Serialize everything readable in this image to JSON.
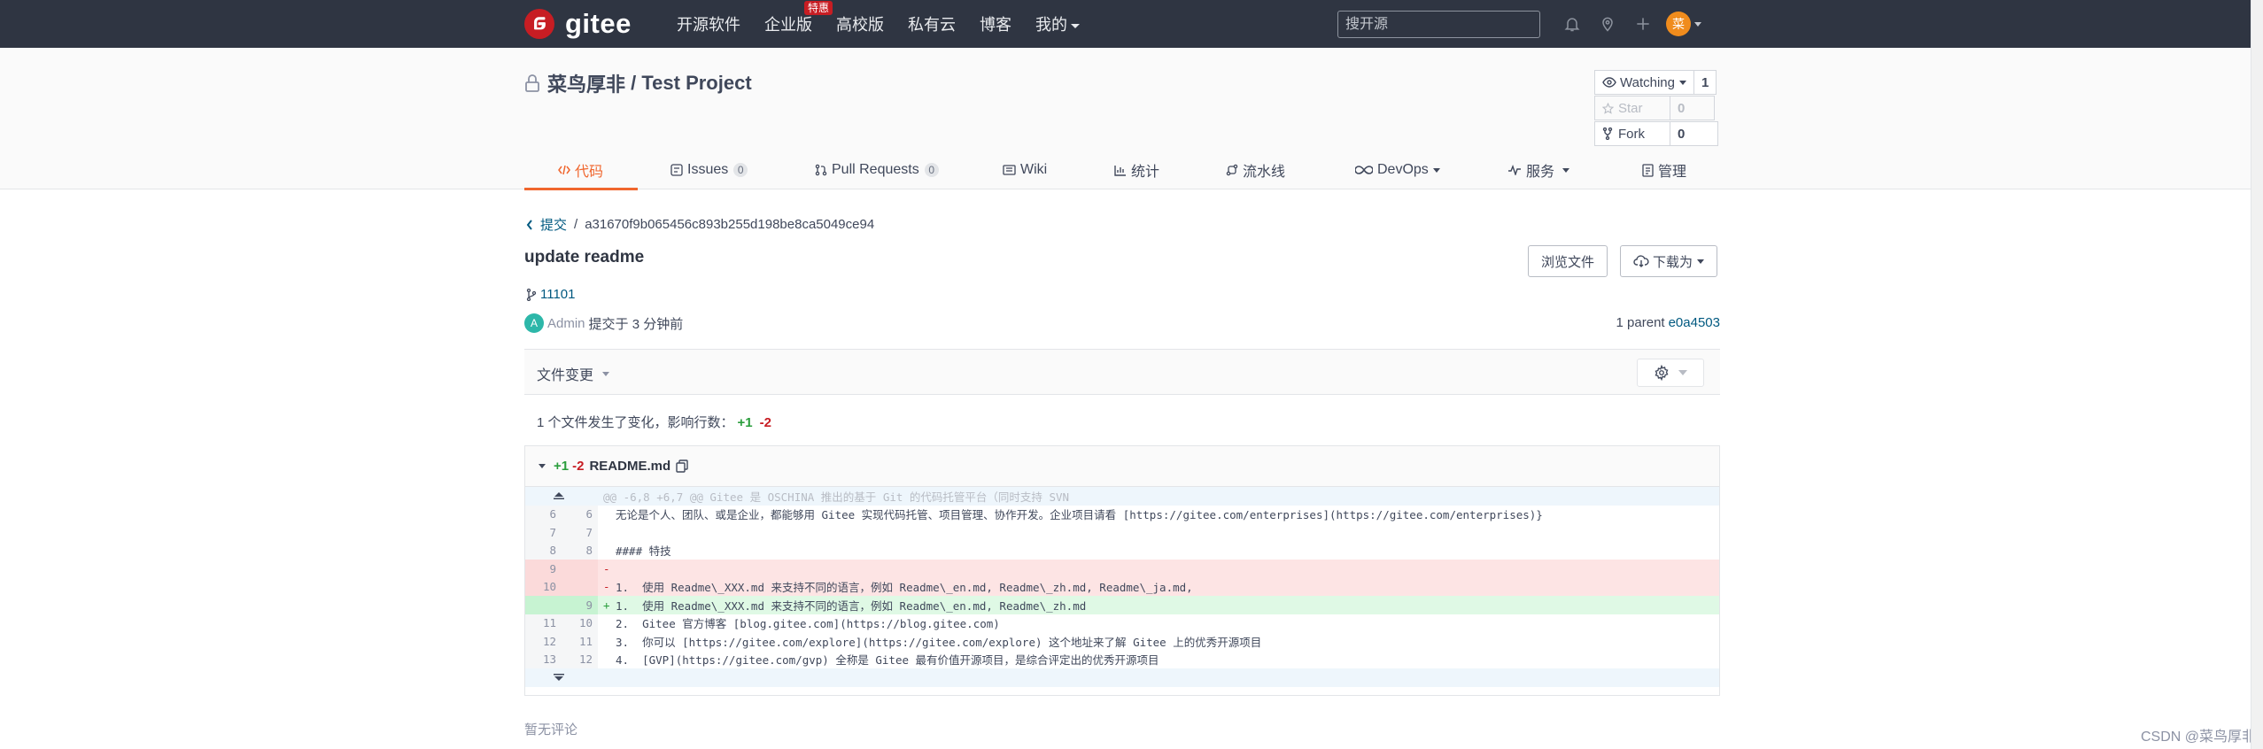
{
  "navbar": {
    "logo_text": "gitee",
    "items": [
      {
        "label": "开源软件"
      },
      {
        "label": "企业版",
        "badge": "特惠"
      },
      {
        "label": "高校版"
      },
      {
        "label": "私有云"
      },
      {
        "label": "博客"
      },
      {
        "label": "我的"
      }
    ],
    "search_placeholder": "搜开源",
    "avatar_text": "菜",
    "icons": [
      "bell-icon",
      "location-icon",
      "plus-icon"
    ]
  },
  "project": {
    "owner": "菜鸟厚非",
    "separator": " / ",
    "name": "Test Project",
    "watch": {
      "label": "Watching",
      "count": "1"
    },
    "star": {
      "label": "Star",
      "count": "0"
    },
    "fork": {
      "label": "Fork",
      "count": "0"
    }
  },
  "tabs": [
    {
      "label": "代码",
      "icon": "code-icon",
      "active": true
    },
    {
      "label": "Issues",
      "count": "0",
      "icon": "issues-icon"
    },
    {
      "label": "Pull Requests",
      "count": "0",
      "icon": "pull-request-icon"
    },
    {
      "label": "Wiki",
      "icon": "wiki-icon"
    },
    {
      "label": "统计",
      "icon": "stats-icon"
    },
    {
      "label": "流水线",
      "icon": "pipeline-icon"
    },
    {
      "label": "DevOps",
      "icon": "devops-icon"
    },
    {
      "label": "服务",
      "icon": "service-icon"
    },
    {
      "label": "管理",
      "icon": "manage-icon"
    }
  ],
  "commit": {
    "breadcrumb_link": "提交",
    "hash": "a31670f9b065456c893b255d198be8ca5049ce94",
    "title": "update readme",
    "browse_button": "浏览文件",
    "download_button": "下载为",
    "branch": "11101",
    "author_initial": "A",
    "author": "Admin",
    "committed_text": "提交于 3 分钟前",
    "parent_label": "1 parent",
    "parent_hash": "e0a4503"
  },
  "changes": {
    "label": "文件变更",
    "summary_prefix": "1 个文件发生了变化，影响行数：",
    "additions": "+1",
    "deletions": "-2"
  },
  "diff": {
    "additions": "+1",
    "deletions": "-2",
    "file_name": "README.md",
    "hunk_header": "@@ -6,8 +6,7 @@ Gitee 是 OSCHINA 推出的基于 Git 的代码托管平台（同时支持 SVN",
    "lines": [
      {
        "type": "ctx",
        "old": "6",
        "new": "6",
        "sign": "",
        "text": "无论是个人、团队、或是企业，都能够用 Gitee 实现代码托管、项目管理、协作开发。企业项目请看 [https://gitee.com/enterprises](https://gitee.com/enterprises)}"
      },
      {
        "type": "ctx",
        "old": "7",
        "new": "7",
        "sign": "",
        "text": ""
      },
      {
        "type": "ctx",
        "old": "8",
        "new": "8",
        "sign": "",
        "text": "#### 特技"
      },
      {
        "type": "del",
        "old": "9",
        "new": "",
        "sign": "-",
        "text": ""
      },
      {
        "type": "del",
        "old": "10",
        "new": "",
        "sign": "-",
        "text": "1.  使用 Readme\\_XXX.md 来支持不同的语言，例如 Readme\\_en.md, Readme\\_zh.md, Readme\\_ja.md,"
      },
      {
        "type": "add",
        "old": "",
        "new": "9",
        "sign": "+",
        "text": "1.  使用 Readme\\_XXX.md 来支持不同的语言，例如 Readme\\_en.md, Readme\\_zh.md"
      },
      {
        "type": "ctx",
        "old": "11",
        "new": "10",
        "sign": "",
        "text": "2.  Gitee 官方博客 [blog.gitee.com](https://blog.gitee.com)"
      },
      {
        "type": "ctx",
        "old": "12",
        "new": "11",
        "sign": "",
        "text": "3.  你可以 [https://gitee.com/explore](https://gitee.com/explore) 这个地址来了解 Gitee 上的优秀开源项目"
      },
      {
        "type": "ctx",
        "old": "13",
        "new": "12",
        "sign": "",
        "text": "4.  [GVP](https://gitee.com/gvp) 全称是 Gitee 最有价值开源项目，是综合评定出的优秀开源项目"
      }
    ]
  },
  "comments": {
    "empty_text": "暂无评论"
  },
  "watermark": "CSDN @菜鸟厚非",
  "colors": {
    "navbar": "#2f3542",
    "accent": "#f0662e",
    "brand": "#c71d23",
    "link": "#005980"
  }
}
